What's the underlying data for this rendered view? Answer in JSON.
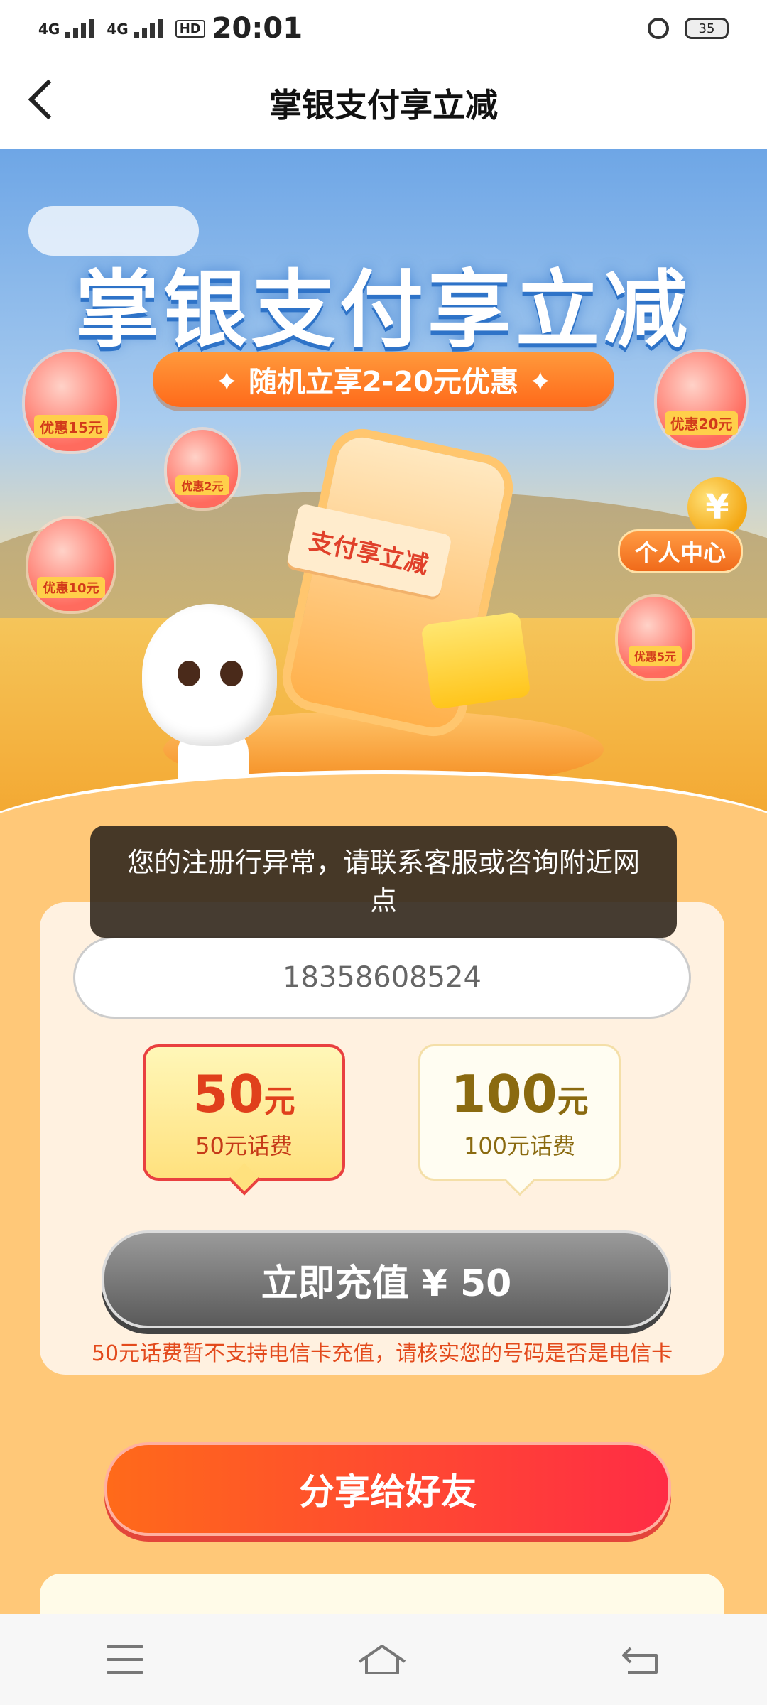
{
  "status_bar": {
    "signal1": "4G",
    "signal2": "4G",
    "hd": "HD",
    "time": "20:01",
    "battery": "35"
  },
  "header": {
    "title": "掌银支付享立减"
  },
  "hero": {
    "title": "掌银支付享立减",
    "subtitle": "✦  随机立享2-20元优惠  ✦",
    "ticket_text": "支付享立减",
    "personal_center": "个人中心",
    "coin_symbol": "¥",
    "balloons": [
      {
        "label": "优惠15元"
      },
      {
        "label": "优惠2元"
      },
      {
        "label": "优惠10元"
      },
      {
        "label": "优惠20元"
      },
      {
        "label": "优惠5元"
      }
    ]
  },
  "toast": {
    "message": "您的注册行异常，请联系客服或咨询附近网点"
  },
  "form": {
    "phone_value": "18358608524"
  },
  "options": [
    {
      "amount": "50",
      "unit": "元",
      "desc": "50元话费",
      "selected": true
    },
    {
      "amount": "100",
      "unit": "元",
      "desc": "100元话费",
      "selected": false
    }
  ],
  "recharge_button": "立即充值 ¥ 50",
  "warning": "50元话费暂不支持电信卡充值，请核实您的号码是否是电信卡",
  "share_button": "分享给好友",
  "colors": {
    "page_bg": "#ffc878",
    "accent_orange": "#ff6a1a",
    "selected_border": "#e94040",
    "warning_text": "#e34a1c"
  },
  "icons": {
    "back": "back-arrow-icon",
    "menu": "menu-icon",
    "home": "home-icon",
    "system_back": "system-back-icon",
    "alarm": "alarm-icon",
    "battery": "battery-icon"
  }
}
